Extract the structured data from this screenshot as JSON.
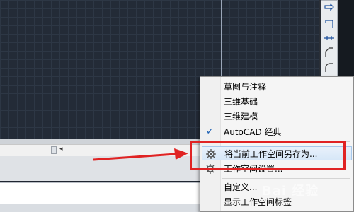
{
  "menu": {
    "items": [
      {
        "label": "草图与注释",
        "checked": false,
        "icon": ""
      },
      {
        "label": "三维基础",
        "checked": false,
        "icon": ""
      },
      {
        "label": "三维建模",
        "checked": false,
        "icon": ""
      },
      {
        "label": "AutoCAD 经典",
        "checked": true,
        "icon": "checkmark-icon"
      },
      {
        "label": "将当前工作空间另存为...",
        "checked": false,
        "icon": "workspace-save-gear-icon"
      },
      {
        "label": "工作空间设置...",
        "checked": false,
        "icon": "workspace-settings-gear-icon"
      },
      {
        "label": "自定义...",
        "checked": false,
        "icon": ""
      },
      {
        "label": "显示工作空间标签",
        "checked": false,
        "icon": ""
      }
    ],
    "check_glyph": "✓"
  },
  "scrollbar": {
    "arrow_glyph": "◂"
  },
  "watermark": "Bai 经验",
  "colors": {
    "canvas_bg": "#232b37",
    "highlight_red": "#e02323",
    "menu_bg": "#f5f5f5",
    "check_blue": "#1a5fb4"
  }
}
